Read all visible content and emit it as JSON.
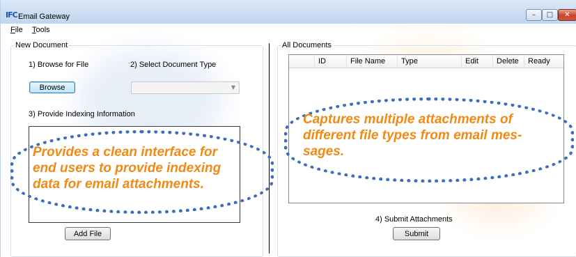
{
  "window": {
    "icon_text": "IFC",
    "title": "Email Gateway"
  },
  "menu": {
    "file": {
      "hotkey": "F",
      "rest": "ile"
    },
    "tools": {
      "hotkey": "T",
      "rest": "ools"
    }
  },
  "new_document": {
    "legend": "New Document",
    "step1": "1) Browse for File",
    "step2": "2) Select Document Type",
    "browse_button": "Browse",
    "document_type_value": "",
    "step3": "3) Provide Indexing Information",
    "add_file_button": "Add File"
  },
  "all_documents": {
    "legend": "All Documents",
    "columns": [
      "ID",
      "File Name",
      "Type",
      "Edit",
      "Delete",
      "Ready"
    ],
    "rows": [],
    "step4": "4) Submit Attachments",
    "submit_button": "Submit"
  },
  "callouts": {
    "left": "Provides a clean interface for end users to provide indexing data for email attachments.",
    "right": "Captures multiple attachments of different file types from email mes-sages."
  },
  "colors": {
    "callout_text": "#f08a14",
    "callout_border": "#3b6fbd"
  }
}
